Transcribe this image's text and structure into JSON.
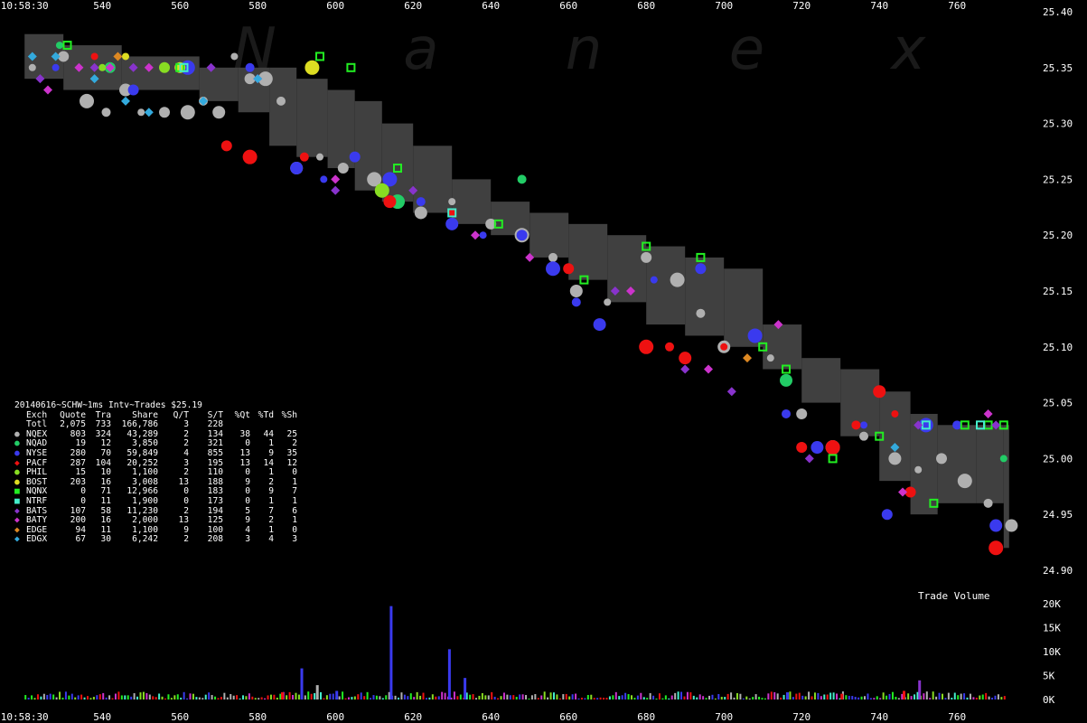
{
  "chart_data": {
    "type": "scatter",
    "title": "20140616~SCHW~1ms Intv~Trades $25.19",
    "watermark": "N a n e x",
    "x_ticks_top": [
      "10:58:30",
      "540",
      "560",
      "580",
      "600",
      "620",
      "640",
      "660",
      "680",
      "700",
      "720",
      "740",
      "760"
    ],
    "x_ticks_bottom": [
      "10:58:30",
      "540",
      "560",
      "580",
      "600",
      "620",
      "640",
      "660",
      "680",
      "700",
      "720",
      "740",
      "760"
    ],
    "x_tick_values": [
      520,
      540,
      560,
      580,
      600,
      620,
      640,
      660,
      680,
      700,
      720,
      740,
      760
    ],
    "x_range": [
      516,
      776
    ],
    "price_ticks": [
      "25.40",
      "25.35",
      "25.30",
      "25.25",
      "25.20",
      "25.15",
      "25.10",
      "25.05",
      "25.00",
      "24.95",
      "24.90"
    ],
    "price_tick_values": [
      25.4,
      25.35,
      25.3,
      25.25,
      25.2,
      25.15,
      25.1,
      25.05,
      25.0,
      24.95,
      24.9
    ],
    "y_range": [
      24.9,
      25.4
    ],
    "volume_label": "Trade Volume",
    "volume_ticks": [
      "20K",
      "15K",
      "10K",
      "5K",
      "0K"
    ],
    "volume_tick_values": [
      20000,
      15000,
      10000,
      5000,
      0
    ],
    "volume_range": [
      0,
      20000
    ],
    "background": "#000000",
    "spread_color": "#404040",
    "spread_band": [
      {
        "x": 520,
        "lo": 25.34,
        "hi": 25.38
      },
      {
        "x": 530,
        "lo": 25.33,
        "hi": 25.37
      },
      {
        "x": 545,
        "lo": 25.33,
        "hi": 25.36
      },
      {
        "x": 565,
        "lo": 25.32,
        "hi": 25.35
      },
      {
        "x": 575,
        "lo": 25.31,
        "hi": 25.35
      },
      {
        "x": 583,
        "lo": 25.28,
        "hi": 25.35
      },
      {
        "x": 590,
        "lo": 25.27,
        "hi": 25.34
      },
      {
        "x": 598,
        "lo": 25.26,
        "hi": 25.33
      },
      {
        "x": 605,
        "lo": 25.24,
        "hi": 25.32
      },
      {
        "x": 612,
        "lo": 25.23,
        "hi": 25.3
      },
      {
        "x": 620,
        "lo": 25.22,
        "hi": 25.28
      },
      {
        "x": 630,
        "lo": 25.21,
        "hi": 25.25
      },
      {
        "x": 640,
        "lo": 25.2,
        "hi": 25.23
      },
      {
        "x": 650,
        "lo": 25.18,
        "hi": 25.22
      },
      {
        "x": 660,
        "lo": 25.16,
        "hi": 25.21
      },
      {
        "x": 670,
        "lo": 25.14,
        "hi": 25.2
      },
      {
        "x": 680,
        "lo": 25.12,
        "hi": 25.19
      },
      {
        "x": 690,
        "lo": 25.11,
        "hi": 25.18
      },
      {
        "x": 700,
        "lo": 25.1,
        "hi": 25.17
      },
      {
        "x": 710,
        "lo": 25.08,
        "hi": 25.12
      },
      {
        "x": 720,
        "lo": 25.05,
        "hi": 25.09
      },
      {
        "x": 730,
        "lo": 25.02,
        "hi": 25.08
      },
      {
        "x": 740,
        "lo": 24.98,
        "hi": 25.06
      },
      {
        "x": 748,
        "lo": 24.95,
        "hi": 25.04
      },
      {
        "x": 755,
        "lo": 24.96,
        "hi": 25.03
      },
      {
        "x": 765,
        "lo": 24.96,
        "hi": 25.03
      },
      {
        "x": 772,
        "lo": 24.92,
        "hi": 25.03
      }
    ],
    "series": [
      {
        "name": "NQEX",
        "color": "#b0b0b0",
        "marker": "circle",
        "points": [
          [
            522,
            25.35
          ],
          [
            530,
            25.36
          ],
          [
            536,
            25.32
          ],
          [
            541,
            25.31
          ],
          [
            546,
            25.33
          ],
          [
            550,
            25.31
          ],
          [
            556,
            25.31
          ],
          [
            562,
            25.31
          ],
          [
            566,
            25.32
          ],
          [
            570,
            25.31
          ],
          [
            574,
            25.36
          ],
          [
            578,
            25.34
          ],
          [
            582,
            25.34
          ],
          [
            586,
            25.32
          ],
          [
            590,
            25.26
          ],
          [
            596,
            25.27
          ],
          [
            602,
            25.26
          ],
          [
            610,
            25.25
          ],
          [
            616,
            25.23
          ],
          [
            622,
            25.22
          ],
          [
            630,
            25.23
          ],
          [
            640,
            25.21
          ],
          [
            648,
            25.2
          ],
          [
            656,
            25.18
          ],
          [
            662,
            25.15
          ],
          [
            670,
            25.14
          ],
          [
            680,
            25.18
          ],
          [
            688,
            25.16
          ],
          [
            694,
            25.13
          ],
          [
            700,
            25.1
          ],
          [
            712,
            25.09
          ],
          [
            720,
            25.04
          ],
          [
            728,
            25.01
          ],
          [
            736,
            25.02
          ],
          [
            744,
            25.0
          ],
          [
            750,
            24.99
          ],
          [
            756,
            25.0
          ],
          [
            762,
            24.98
          ],
          [
            768,
            24.96
          ],
          [
            774,
            24.94
          ]
        ]
      },
      {
        "name": "NQAD",
        "color": "#22cc66",
        "marker": "circle",
        "points": [
          [
            529,
            25.37
          ],
          [
            542,
            25.35
          ],
          [
            616,
            25.23
          ],
          [
            648,
            25.25
          ],
          [
            716,
            25.07
          ],
          [
            772,
            25.0
          ]
        ]
      },
      {
        "name": "NYSE",
        "color": "#3a3aee",
        "marker": "circle",
        "points": [
          [
            528,
            25.35
          ],
          [
            548,
            25.33
          ],
          [
            562,
            25.35
          ],
          [
            578,
            25.35
          ],
          [
            590,
            25.26
          ],
          [
            597,
            25.25
          ],
          [
            605,
            25.27
          ],
          [
            614,
            25.25
          ],
          [
            622,
            25.23
          ],
          [
            630,
            25.21
          ],
          [
            638,
            25.2
          ],
          [
            648,
            25.2
          ],
          [
            656,
            25.17
          ],
          [
            662,
            25.14
          ],
          [
            668,
            25.12
          ],
          [
            682,
            25.16
          ],
          [
            694,
            25.17
          ],
          [
            708,
            25.11
          ],
          [
            716,
            25.04
          ],
          [
            724,
            25.01
          ],
          [
            736,
            25.03
          ],
          [
            742,
            24.95
          ],
          [
            752,
            25.03
          ],
          [
            760,
            25.03
          ],
          [
            770,
            24.94
          ]
        ]
      },
      {
        "name": "PACF",
        "color": "#ee1111",
        "marker": "circle",
        "points": [
          [
            538,
            25.36
          ],
          [
            572,
            25.28
          ],
          [
            578,
            25.27
          ],
          [
            592,
            25.27
          ],
          [
            614,
            25.23
          ],
          [
            630,
            25.22
          ],
          [
            660,
            25.17
          ],
          [
            680,
            25.1
          ],
          [
            686,
            25.1
          ],
          [
            690,
            25.09
          ],
          [
            700,
            25.1
          ],
          [
            720,
            25.01
          ],
          [
            728,
            25.01
          ],
          [
            734,
            25.03
          ],
          [
            740,
            25.06
          ],
          [
            744,
            25.04
          ],
          [
            748,
            24.97
          ],
          [
            770,
            24.92
          ]
        ]
      },
      {
        "name": "PHIL",
        "color": "#88dd22",
        "marker": "circle",
        "points": [
          [
            540,
            25.35
          ],
          [
            556,
            25.35
          ],
          [
            612,
            25.24
          ]
        ]
      },
      {
        "name": "BOST",
        "color": "#dddd22",
        "marker": "circle",
        "points": [
          [
            546,
            25.36
          ],
          [
            560,
            25.35
          ],
          [
            594,
            25.35
          ]
        ]
      },
      {
        "name": "NQNX",
        "color": "#22ee22",
        "marker": "square",
        "points": [
          [
            531,
            25.37
          ],
          [
            560,
            25.35
          ],
          [
            596,
            25.36
          ],
          [
            604,
            25.35
          ],
          [
            616,
            25.26
          ],
          [
            642,
            25.21
          ],
          [
            664,
            25.16
          ],
          [
            680,
            25.19
          ],
          [
            694,
            25.18
          ],
          [
            710,
            25.1
          ],
          [
            716,
            25.08
          ],
          [
            728,
            25.0
          ],
          [
            740,
            25.02
          ],
          [
            754,
            24.96
          ],
          [
            762,
            25.03
          ],
          [
            768,
            25.03
          ],
          [
            772,
            25.03
          ]
        ]
      },
      {
        "name": "NTRF",
        "color": "#44eecc",
        "marker": "square",
        "points": [
          [
            561,
            25.35
          ],
          [
            630,
            25.22
          ],
          [
            752,
            25.03
          ],
          [
            766,
            25.03
          ]
        ]
      },
      {
        "name": "BATS",
        "color": "#8833cc",
        "marker": "diamond",
        "points": [
          [
            524,
            25.34
          ],
          [
            538,
            25.35
          ],
          [
            548,
            25.35
          ],
          [
            568,
            25.35
          ],
          [
            600,
            25.24
          ],
          [
            620,
            25.24
          ],
          [
            672,
            25.15
          ],
          [
            690,
            25.08
          ],
          [
            702,
            25.06
          ],
          [
            722,
            25.0
          ],
          [
            750,
            25.03
          ],
          [
            770,
            25.03
          ]
        ]
      },
      {
        "name": "BATY",
        "color": "#cc33cc",
        "marker": "diamond",
        "points": [
          [
            526,
            25.33
          ],
          [
            534,
            25.35
          ],
          [
            542,
            25.35
          ],
          [
            552,
            25.35
          ],
          [
            580,
            25.34
          ],
          [
            600,
            25.25
          ],
          [
            636,
            25.2
          ],
          [
            650,
            25.18
          ],
          [
            676,
            25.15
          ],
          [
            696,
            25.08
          ],
          [
            714,
            25.12
          ],
          [
            746,
            24.97
          ],
          [
            768,
            25.04
          ]
        ]
      },
      {
        "name": "EDGE",
        "color": "#dd8822",
        "marker": "diamond",
        "points": [
          [
            544,
            25.36
          ],
          [
            706,
            25.09
          ]
        ]
      },
      {
        "name": "EDGX",
        "color": "#33aadd",
        "marker": "diamond",
        "points": [
          [
            522,
            25.36
          ],
          [
            528,
            25.36
          ],
          [
            538,
            25.34
          ],
          [
            546,
            25.32
          ],
          [
            552,
            25.31
          ],
          [
            566,
            25.32
          ],
          [
            580,
            25.34
          ],
          [
            744,
            25.01
          ]
        ]
      }
    ],
    "volume_bars": [
      {
        "x": 591,
        "v": 6500,
        "color": "#3a3aee"
      },
      {
        "x": 595,
        "v": 3000,
        "color": "#b0b0b0"
      },
      {
        "x": 600,
        "v": 1800,
        "color": "#3a3aee"
      },
      {
        "x": 614,
        "v": 19500,
        "color": "#3a3aee"
      },
      {
        "x": 629,
        "v": 10500,
        "color": "#3a3aee"
      },
      {
        "x": 633,
        "v": 4500,
        "color": "#3a3aee"
      },
      {
        "x": 586,
        "v": 1500,
        "color": "#ee1111"
      },
      {
        "x": 750,
        "v": 4000,
        "color": "#8833cc"
      },
      {
        "x": 746,
        "v": 1800,
        "color": "#ee1111"
      },
      {
        "x": 716,
        "v": 1500,
        "color": "#3a3aee"
      },
      {
        "x": 730,
        "v": 1200,
        "color": "#ee1111"
      }
    ],
    "volume_noise_colors": [
      "#b0b0b0",
      "#3a3aee",
      "#ee1111",
      "#22ee22",
      "#cc33cc",
      "#44eecc",
      "#88dd22"
    ],
    "stats_table": {
      "header": [
        "Exch",
        "Quote",
        "Tra",
        "Share",
        "Q/T",
        "S/T",
        "%Qt",
        "%Td",
        "%Sh"
      ],
      "total": [
        "Totl",
        "2,075",
        "733",
        "166,786",
        "3",
        "228",
        "",
        "",
        ""
      ],
      "rows": [
        {
          "marker": "circle",
          "color": "#b0b0b0",
          "cells": [
            "NQEX",
            "803",
            "324",
            "43,289",
            "2",
            "134",
            "38",
            "44",
            "25"
          ]
        },
        {
          "marker": "circle",
          "color": "#22cc66",
          "cells": [
            "NQAD",
            "19",
            "12",
            "3,850",
            "2",
            "321",
            "0",
            "1",
            "2"
          ]
        },
        {
          "marker": "circle",
          "color": "#3a3aee",
          "cells": [
            "NYSE",
            "280",
            "70",
            "59,849",
            "4",
            "855",
            "13",
            "9",
            "35"
          ]
        },
        {
          "marker": "diamond",
          "color": "#ee1111",
          "cells": [
            "PACF",
            "287",
            "104",
            "20,252",
            "3",
            "195",
            "13",
            "14",
            "12"
          ]
        },
        {
          "marker": "circle",
          "color": "#88dd22",
          "cells": [
            "PHIL",
            "15",
            "10",
            "1,100",
            "2",
            "110",
            "0",
            "1",
            "0"
          ]
        },
        {
          "marker": "circle",
          "color": "#dddd22",
          "cells": [
            "BOST",
            "203",
            "16",
            "3,008",
            "13",
            "188",
            "9",
            "2",
            "1"
          ]
        },
        {
          "marker": "square",
          "color": "#22ee22",
          "cells": [
            "NQNX",
            "0",
            "71",
            "12,966",
            "0",
            "183",
            "0",
            "9",
            "7"
          ]
        },
        {
          "marker": "square",
          "color": "#44eecc",
          "cells": [
            "NTRF",
            "0",
            "11",
            "1,900",
            "0",
            "173",
            "0",
            "1",
            "1"
          ]
        },
        {
          "marker": "diamond",
          "color": "#8833cc",
          "cells": [
            "BATS",
            "107",
            "58",
            "11,230",
            "2",
            "194",
            "5",
            "7",
            "6"
          ]
        },
        {
          "marker": "diamond",
          "color": "#cc33cc",
          "cells": [
            "BATY",
            "200",
            "16",
            "2,000",
            "13",
            "125",
            "9",
            "2",
            "1"
          ]
        },
        {
          "marker": "diamond",
          "color": "#dd8822",
          "cells": [
            "EDGE",
            "94",
            "11",
            "1,100",
            "9",
            "100",
            "4",
            "1",
            "0"
          ]
        },
        {
          "marker": "diamond",
          "color": "#33aadd",
          "cells": [
            "EDGX",
            "67",
            "30",
            "6,242",
            "2",
            "208",
            "3",
            "4",
            "3"
          ]
        }
      ]
    }
  }
}
